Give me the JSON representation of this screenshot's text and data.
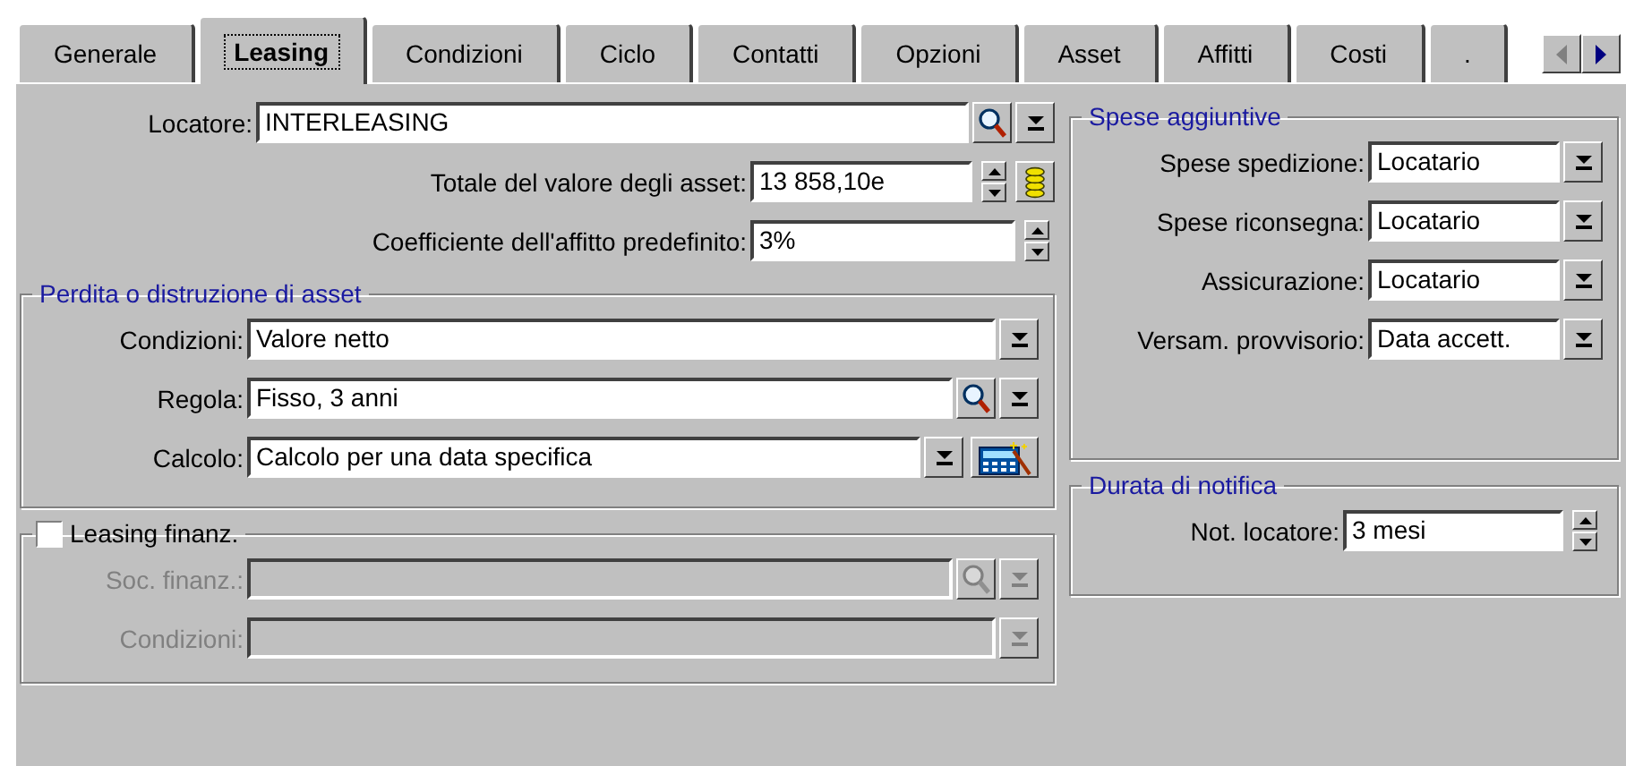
{
  "tabs": [
    {
      "label": "Generale",
      "selected": false
    },
    {
      "label": "Leasing",
      "selected": true
    },
    {
      "label": "Condizioni",
      "selected": false
    },
    {
      "label": "Ciclo",
      "selected": false
    },
    {
      "label": "Contatti",
      "selected": false
    },
    {
      "label": "Opzioni",
      "selected": false
    },
    {
      "label": "Asset",
      "selected": false
    },
    {
      "label": "Affitti",
      "selected": false
    },
    {
      "label": "Costi",
      "selected": false
    },
    {
      "label": ".",
      "selected": false
    }
  ],
  "main_fields": [
    {
      "label": "Locatore:",
      "value": "INTERLEASING",
      "kind": "lookup"
    },
    {
      "label": "Totale del valore degli asset:",
      "value": "13 858,10e",
      "kind": "money"
    },
    {
      "label": "Coefficiente dell'affitto predefinito:",
      "value": "3%",
      "kind": "spin"
    }
  ],
  "loss_group": {
    "title": "Perdita o distruzione di asset",
    "fields": [
      {
        "label": "Condizioni:",
        "value": "Valore netto",
        "kind": "dropdown"
      },
      {
        "label": "Regola:",
        "value": "Fisso, 3 anni",
        "kind": "lookup"
      },
      {
        "label": "Calcolo:",
        "value": "Calcolo per una data specifica",
        "kind": "calc"
      }
    ]
  },
  "finance_group": {
    "label": "Leasing finanz.",
    "checked": false,
    "fields": [
      {
        "label": "Soc. finanz.:",
        "kind": "lookup",
        "disabled": true
      },
      {
        "label": "Condizioni:",
        "kind": "dropdown",
        "disabled": true
      }
    ]
  },
  "extra_costs_group": {
    "title": "Spese aggiuntive",
    "fields": [
      {
        "label": "Spese spedizione:",
        "value": "Locatario",
        "kind": "dropdown"
      },
      {
        "label": "Spese riconsegna:",
        "value": "Locatario",
        "kind": "dropdown"
      },
      {
        "label": "Assicurazione:",
        "value": "Locatario",
        "kind": "dropdown"
      },
      {
        "label": "Versam. provvisorio:",
        "value": "Data accett.",
        "kind": "dropdown"
      }
    ]
  },
  "notice_group": {
    "title": "Durata di notifica",
    "fields": [
      {
        "label": "Not. locatore:",
        "value": "3 mesi",
        "kind": "spin"
      }
    ]
  }
}
